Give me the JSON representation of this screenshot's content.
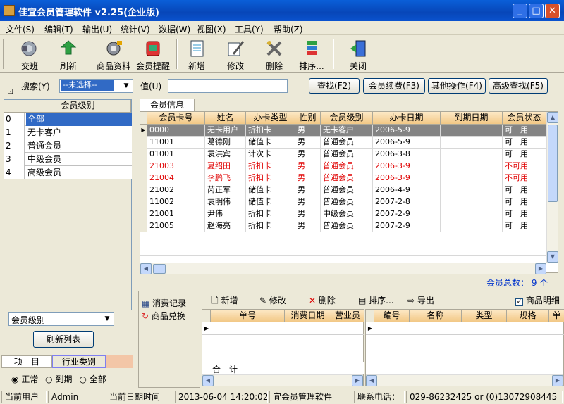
{
  "window": {
    "title": "佳宜会员管理软件  v2.25(企业版)",
    "controls": [
      "_",
      "□",
      "✕"
    ]
  },
  "menu": [
    "文件(S)",
    "编辑(T)",
    "输出(U)",
    "统计(V)",
    "数据(W)",
    "视图(X)",
    "工具(Y)",
    "帮助(Z)"
  ],
  "toolbar": {
    "buttons": [
      {
        "label": "交班",
        "icon": "handover-icon"
      },
      {
        "label": "刷新",
        "icon": "refresh-icon"
      },
      {
        "label": "商品资料",
        "icon": "goods-icon"
      },
      {
        "label": "会员提醒",
        "icon": "reminder-icon"
      },
      {
        "label": "新增",
        "icon": "new-icon"
      },
      {
        "label": "修改",
        "icon": "edit-icon"
      },
      {
        "label": "删除",
        "icon": "delete-icon"
      },
      {
        "label": "排序...",
        "icon": "sort-icon"
      },
      {
        "label": "关闭",
        "icon": "close-icon"
      }
    ]
  },
  "search": {
    "label": "搜索(Y)",
    "field_value": "--未选择--",
    "value_label": "值(U)",
    "value_input": "",
    "buttons": [
      "查找(F2)",
      "会员续费(F3)",
      "其他操作(F4)",
      "高级查找(F5)"
    ]
  },
  "levels": {
    "header": "会员级别",
    "rows": [
      {
        "idx": "0",
        "name": "全部"
      },
      {
        "idx": "1",
        "name": "无卡客户"
      },
      {
        "idx": "2",
        "name": "普通会员"
      },
      {
        "idx": "3",
        "name": "中级会员"
      },
      {
        "idx": "4",
        "name": "高级会员"
      }
    ],
    "filter_value": "会员级别",
    "refresh_button": "刷新列表",
    "tabs": [
      "项　目",
      "行业类别"
    ],
    "radios": [
      "正常",
      "到期",
      "全部"
    ]
  },
  "members": {
    "tab": "会员信息",
    "columns": [
      "会员卡号",
      "姓名",
      "办卡类型",
      "性别",
      "会员级别",
      "办卡日期",
      "到期日期",
      "会员状态"
    ],
    "rows": [
      [
        "0000",
        "无卡用户",
        "折扣卡",
        "男",
        "无卡客户",
        "2006-5-9",
        "",
        "可　用"
      ],
      [
        "11001",
        "葛德刚",
        "储值卡",
        "男",
        "普通会员",
        "2006-5-9",
        "",
        "可　用"
      ],
      [
        "01001",
        "袁洪宾",
        "计次卡",
        "男",
        "普通会员",
        "2006-3-8",
        "",
        "可　用"
      ],
      [
        "21003",
        "夏绍田",
        "折扣卡",
        "男",
        "普通会员",
        "2006-3-9",
        "",
        "不可用"
      ],
      [
        "21004",
        "李鹏飞",
        "折扣卡",
        "男",
        "普通会员",
        "2006-3-9",
        "",
        "不可用"
      ],
      [
        "21002",
        "芮正军",
        "储值卡",
        "男",
        "普通会员",
        "2006-4-9",
        "",
        "可　用"
      ],
      [
        "11002",
        "袁明伟",
        "储值卡",
        "男",
        "普通会员",
        "2007-2-8",
        "",
        "可　用"
      ],
      [
        "21001",
        "尹伟",
        "折扣卡",
        "男",
        "中级会员",
        "2007-2-9",
        "",
        "可　用"
      ],
      [
        "21005",
        "赵海亮",
        "折扣卡",
        "男",
        "普通会员",
        "2007-2-9",
        "",
        "可　用"
      ]
    ],
    "red_rows": [
      3,
      4
    ],
    "selected_row": 0,
    "total": "会员总数： 9 个"
  },
  "sub": {
    "side_tabs": [
      "消费记录",
      "商品兑换"
    ],
    "toolbar": [
      "新增",
      "修改",
      "删除",
      "排序...",
      "导出"
    ],
    "checkbox_label": "商品明细",
    "left_columns": [
      "单号",
      "消费日期",
      "营业员"
    ],
    "right_columns": [
      "编号",
      "名称",
      "类型",
      "规格",
      "单"
    ],
    "total_label": "合　计"
  },
  "status": {
    "user_label": "当前用户",
    "user": "Admin",
    "time_label": "当前日期时间",
    "time": "2013-06-04 14:20:02",
    "app": "宜会员管理软件",
    "phone_label": "联系电话：",
    "phone": "029-86232425 or (0)13072908445"
  },
  "colors": {
    "title_bar": "#0a52cf",
    "header_orange": "#f2c886",
    "selection_blue": "#316ac5",
    "red_text": "#e00000"
  }
}
